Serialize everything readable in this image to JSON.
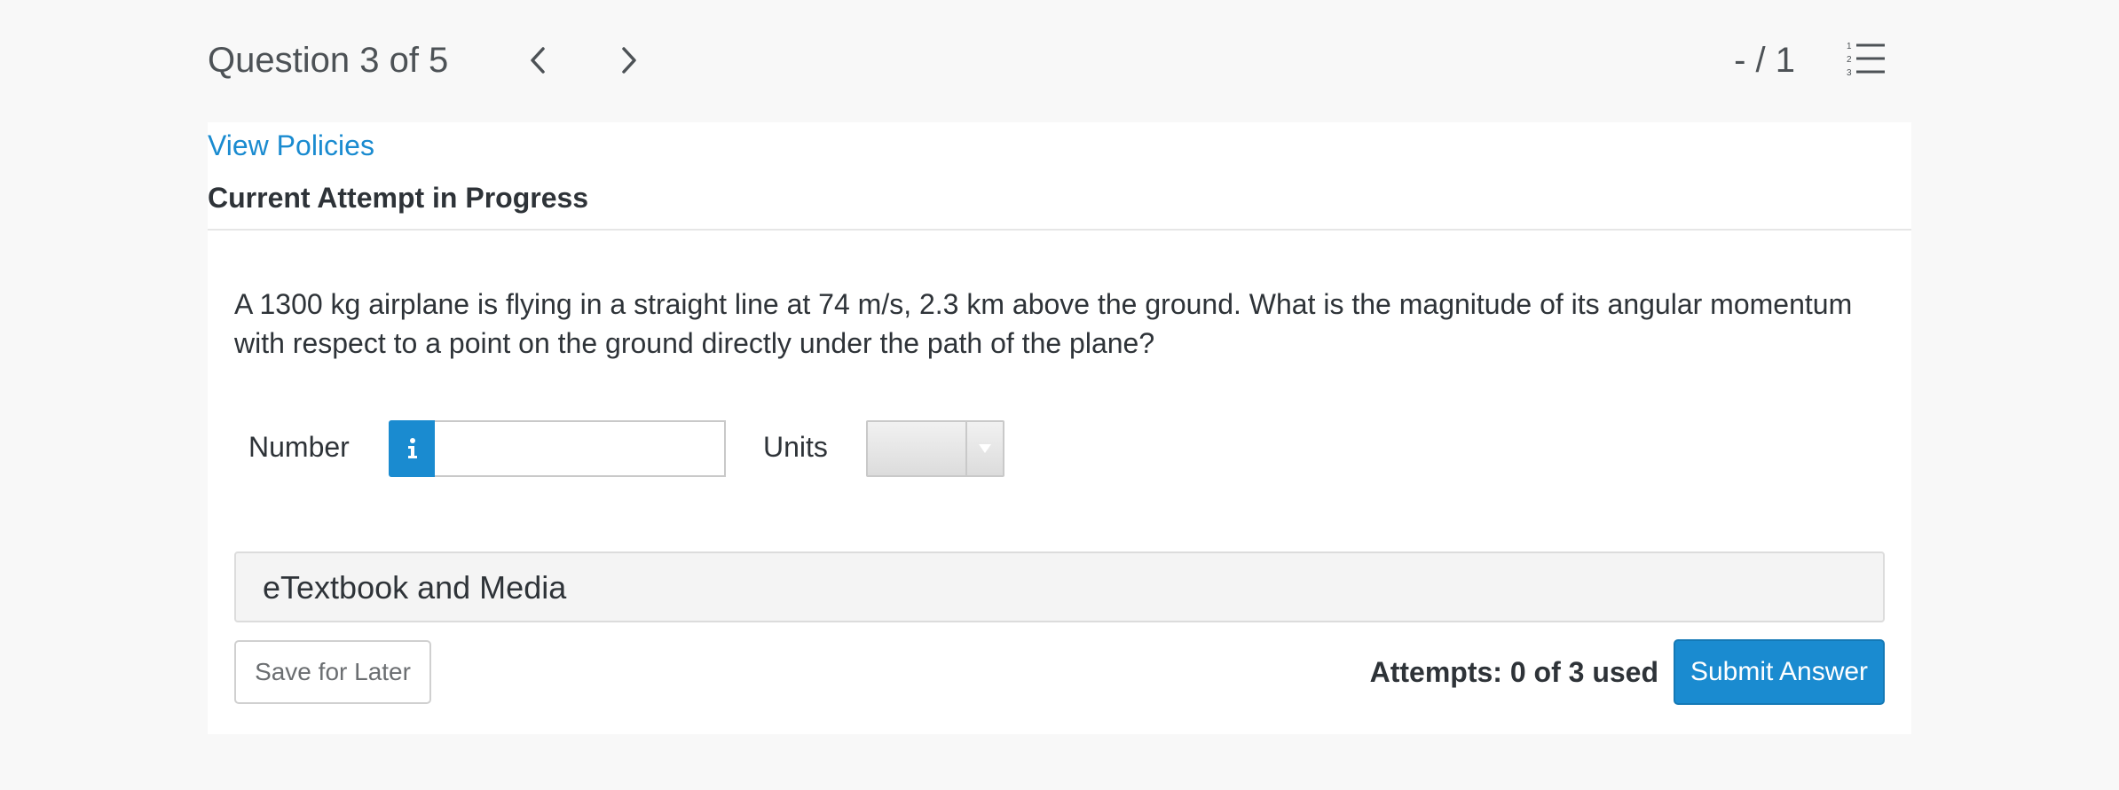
{
  "header": {
    "question_title": "Question 3 of 5",
    "prev_icon": "chevron-left-icon",
    "next_icon": "chevron-right-icon",
    "score": "- / 1",
    "list_icon": "numbered-list-icon"
  },
  "links": {
    "view_policies": "View Policies"
  },
  "status": {
    "heading": "Current Attempt in Progress"
  },
  "question": {
    "text": "A 1300 kg airplane is flying in a straight line at 74 m/s, 2.3 km above the ground. What is the magnitude of its angular momentum with respect to a point on the ground directly under the path of the plane?"
  },
  "answer": {
    "number_label": "Number",
    "info_icon": "info-icon",
    "number_value": "",
    "units_label": "Units",
    "units_selected": ""
  },
  "resources": {
    "etextbook_label": "eTextbook and Media"
  },
  "footer": {
    "save_label": "Save for Later",
    "attempts_text": "Attempts: 0 of 3 used",
    "submit_label": "Submit Answer"
  },
  "colors": {
    "accent": "#1a8bd0",
    "text": "#2e3338",
    "background": "#f8f8f8"
  }
}
